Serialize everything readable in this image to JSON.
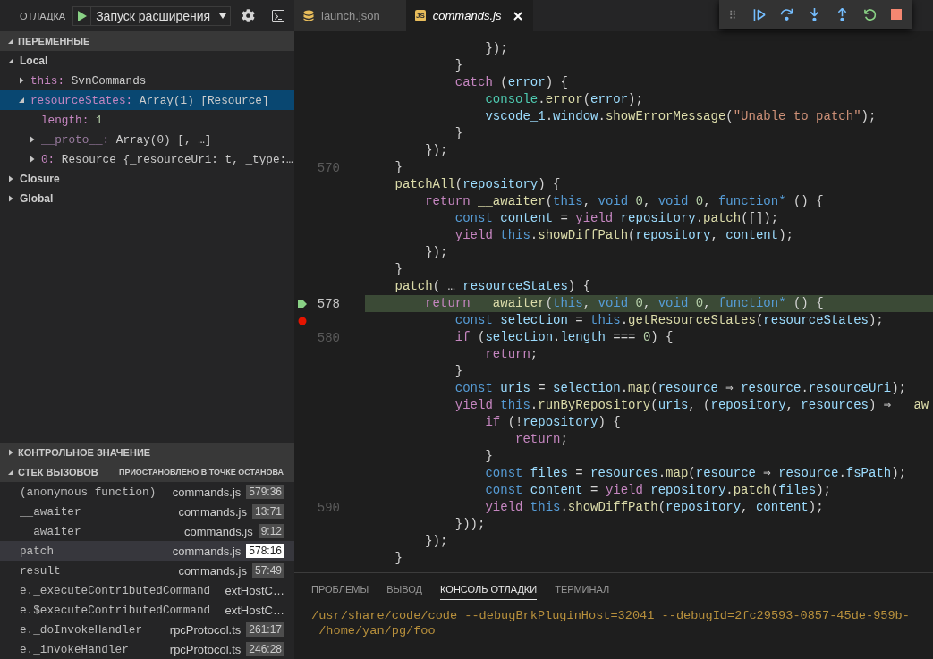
{
  "sidebar": {
    "title": "ОТЛАДКА",
    "config": {
      "label": "Запуск расширения"
    },
    "variables": {
      "title": "ПЕРЕМЕННЫЕ",
      "expanded": true,
      "items": [
        {
          "kind": "scope",
          "name": "Local",
          "expanded": true,
          "selected": false,
          "children": [
            {
              "kind": "object",
              "name": "this:",
              "value": "SvnCommands",
              "expanded": false,
              "selected": false
            },
            {
              "kind": "object",
              "name": "resourceStates:",
              "value": "Array(1) [Resource]",
              "expanded": true,
              "selected": true,
              "children": [
                {
                  "kind": "number",
                  "name": "length:",
                  "value": "1",
                  "selected": false
                },
                {
                  "kind": "object",
                  "name": "__proto__:",
                  "value": "Array(0) [, …]",
                  "expanded": false,
                  "selected": false
                },
                {
                  "kind": "object",
                  "name": "0:",
                  "value": "Resource {_resourceUri: t, _type:…",
                  "expanded": false,
                  "selected": false
                }
              ]
            }
          ]
        },
        {
          "kind": "scope",
          "name": "Closure",
          "expanded": false,
          "selected": false
        },
        {
          "kind": "scope",
          "name": "Global",
          "expanded": false,
          "selected": false
        }
      ]
    },
    "watch": {
      "title": "КОНТРОЛЬНОЕ ЗНАЧЕНИЕ",
      "expanded": false
    },
    "call_stack": {
      "title": "СТЕК ВЫЗОВОВ",
      "expanded": true,
      "status": "ПРИОСТАНОВЛЕНО В ТОЧКЕ ОСТАНОВА",
      "frames": [
        {
          "name": "(anonymous function)",
          "file": "commands.js",
          "position": "579:36",
          "selected": false
        },
        {
          "name": "__awaiter",
          "file": "commands.js",
          "position": "13:71",
          "selected": false
        },
        {
          "name": "__awaiter",
          "file": "commands.js",
          "position": "9:12",
          "selected": false
        },
        {
          "name": "patch",
          "file": "commands.js",
          "position": "578:16",
          "selected": true
        },
        {
          "name": "result",
          "file": "commands.js",
          "position": "57:49",
          "selected": false
        },
        {
          "name": "e._executeContributedCommand",
          "file": "extHostC…",
          "selected": false
        },
        {
          "name": "e.$executeContributedCommand",
          "file": "extHostC…",
          "selected": false
        },
        {
          "name": "e._doInvokeHandler",
          "file": "rpcProtocol.ts",
          "position": "261:17",
          "selected": false
        },
        {
          "name": "e._invokeHandler",
          "file": "rpcProtocol.ts",
          "position": "246:28",
          "selected": false
        }
      ]
    }
  },
  "tabs": [
    {
      "label": "launch.json",
      "kind": "json",
      "selected": false
    },
    {
      "label": "commands.js",
      "kind": "js",
      "badge": "JS",
      "selected": true
    }
  ],
  "debug_toolbar": [
    {
      "kind": "continue"
    },
    {
      "kind": "step-over"
    },
    {
      "kind": "step-into"
    },
    {
      "kind": "step-out"
    },
    {
      "kind": "restart"
    },
    {
      "kind": "stop"
    }
  ],
  "code": {
    "lines": [
      {
        "current": false,
        "breakpoint": false,
        "tokens": [
          {
            "kind": "p",
            "text": "                });"
          }
        ]
      },
      {
        "current": false,
        "breakpoint": false,
        "tokens": [
          {
            "kind": "p",
            "text": "            }"
          }
        ]
      },
      {
        "current": false,
        "breakpoint": false,
        "tokens": [
          {
            "kind": "kw",
            "text": "            catch "
          },
          {
            "kind": "p",
            "text": "("
          },
          {
            "kind": "var",
            "text": "error"
          },
          {
            "kind": "p",
            "text": ") {"
          }
        ]
      },
      {
        "current": false,
        "breakpoint": false,
        "tokens": [
          {
            "kind": "cls",
            "text": "                console"
          },
          {
            "kind": "p",
            "text": "."
          },
          {
            "kind": "fn",
            "text": "error"
          },
          {
            "kind": "p",
            "text": "("
          },
          {
            "kind": "var",
            "text": "error"
          },
          {
            "kind": "p",
            "text": ");"
          }
        ]
      },
      {
        "current": false,
        "breakpoint": false,
        "tokens": [
          {
            "kind": "var",
            "text": "                vscode_1"
          },
          {
            "kind": "p",
            "text": "."
          },
          {
            "kind": "var",
            "text": "window"
          },
          {
            "kind": "p",
            "text": "."
          },
          {
            "kind": "fn",
            "text": "showErrorMessage"
          },
          {
            "kind": "p",
            "text": "("
          },
          {
            "kind": "str",
            "text": "\"Unable to patch\""
          },
          {
            "kind": "p",
            "text": ");"
          }
        ]
      },
      {
        "current": false,
        "breakpoint": false,
        "tokens": [
          {
            "kind": "p",
            "text": "            }"
          }
        ]
      },
      {
        "current": false,
        "breakpoint": false,
        "tokens": [
          {
            "kind": "p",
            "text": "        });"
          }
        ]
      },
      {
        "number": "570",
        "current": false,
        "breakpoint": false,
        "tokens": [
          {
            "kind": "p",
            "text": "    }"
          }
        ]
      },
      {
        "current": false,
        "breakpoint": false,
        "tokens": [
          {
            "kind": "fn",
            "text": "    patchAll"
          },
          {
            "kind": "p",
            "text": "("
          },
          {
            "kind": "var",
            "text": "repository"
          },
          {
            "kind": "p",
            "text": ") {"
          }
        ]
      },
      {
        "current": false,
        "breakpoint": false,
        "tokens": [
          {
            "kind": "kw",
            "text": "        return "
          },
          {
            "kind": "fn",
            "text": "__awaiter"
          },
          {
            "kind": "p",
            "text": "("
          },
          {
            "kind": "st",
            "text": "this"
          },
          {
            "kind": "p",
            "text": ", "
          },
          {
            "kind": "st",
            "text": "void "
          },
          {
            "kind": "num",
            "text": "0"
          },
          {
            "kind": "p",
            "text": ", "
          },
          {
            "kind": "st",
            "text": "void "
          },
          {
            "kind": "num",
            "text": "0"
          },
          {
            "kind": "p",
            "text": ", "
          },
          {
            "kind": "st",
            "text": "function* "
          },
          {
            "kind": "p",
            "text": "() {"
          }
        ]
      },
      {
        "current": false,
        "breakpoint": false,
        "tokens": [
          {
            "kind": "st",
            "text": "            const "
          },
          {
            "kind": "var",
            "text": "content"
          },
          {
            "kind": "p",
            "text": " = "
          },
          {
            "kind": "kw",
            "text": "yield "
          },
          {
            "kind": "var",
            "text": "repository"
          },
          {
            "kind": "p",
            "text": "."
          },
          {
            "kind": "fn",
            "text": "patch"
          },
          {
            "kind": "p",
            "text": "([]);"
          }
        ]
      },
      {
        "current": false,
        "breakpoint": false,
        "tokens": [
          {
            "kind": "kw",
            "text": "            yield "
          },
          {
            "kind": "st",
            "text": "this"
          },
          {
            "kind": "p",
            "text": "."
          },
          {
            "kind": "fn",
            "text": "showDiffPath"
          },
          {
            "kind": "p",
            "text": "("
          },
          {
            "kind": "var",
            "text": "repository"
          },
          {
            "kind": "p",
            "text": ", "
          },
          {
            "kind": "var",
            "text": "content"
          },
          {
            "kind": "p",
            "text": ");"
          }
        ]
      },
      {
        "current": false,
        "breakpoint": false,
        "tokens": [
          {
            "kind": "p",
            "text": "        });"
          }
        ]
      },
      {
        "current": false,
        "breakpoint": false,
        "tokens": [
          {
            "kind": "p",
            "text": "    }"
          }
        ]
      },
      {
        "current": false,
        "breakpoint": false,
        "tokens": [
          {
            "kind": "fn",
            "text": "    patch"
          },
          {
            "kind": "p",
            "text": "( … "
          },
          {
            "kind": "var",
            "text": "resourceStates"
          },
          {
            "kind": "p",
            "text": ") {"
          }
        ]
      },
      {
        "number": "578",
        "current": true,
        "breakpoint": false,
        "tokens": [
          {
            "kind": "kw",
            "text": "        return "
          },
          {
            "kind": "fn",
            "text": "__awaiter"
          },
          {
            "kind": "p",
            "text": "("
          },
          {
            "kind": "st",
            "text": "this"
          },
          {
            "kind": "p",
            "text": ", "
          },
          {
            "kind": "st",
            "text": "void "
          },
          {
            "kind": "num",
            "text": "0"
          },
          {
            "kind": "p",
            "text": ", "
          },
          {
            "kind": "st",
            "text": "void "
          },
          {
            "kind": "num",
            "text": "0"
          },
          {
            "kind": "p",
            "text": ", "
          },
          {
            "kind": "st",
            "text": "function* "
          },
          {
            "kind": "p",
            "text": "() {"
          }
        ]
      },
      {
        "current": false,
        "breakpoint": true,
        "tokens": [
          {
            "kind": "st",
            "text": "            const "
          },
          {
            "kind": "var",
            "text": "selection"
          },
          {
            "kind": "p",
            "text": " = "
          },
          {
            "kind": "st",
            "text": "this"
          },
          {
            "kind": "p",
            "text": "."
          },
          {
            "kind": "fn",
            "text": "getResourceStates"
          },
          {
            "kind": "p",
            "text": "("
          },
          {
            "kind": "var",
            "text": "resourceStates"
          },
          {
            "kind": "p",
            "text": ");"
          }
        ]
      },
      {
        "number": "580",
        "current": false,
        "breakpoint": false,
        "tokens": [
          {
            "kind": "kw",
            "text": "            if "
          },
          {
            "kind": "p",
            "text": "("
          },
          {
            "kind": "var",
            "text": "selection"
          },
          {
            "kind": "p",
            "text": "."
          },
          {
            "kind": "var",
            "text": "length"
          },
          {
            "kind": "p",
            "text": " === "
          },
          {
            "kind": "num",
            "text": "0"
          },
          {
            "kind": "p",
            "text": ") {"
          }
        ]
      },
      {
        "current": false,
        "breakpoint": false,
        "tokens": [
          {
            "kind": "kw",
            "text": "                return"
          },
          {
            "kind": "p",
            "text": ";"
          }
        ]
      },
      {
        "current": false,
        "breakpoint": false,
        "tokens": [
          {
            "kind": "p",
            "text": "            }"
          }
        ]
      },
      {
        "current": false,
        "breakpoint": false,
        "tokens": [
          {
            "kind": "st",
            "text": "            const "
          },
          {
            "kind": "var",
            "text": "uris"
          },
          {
            "kind": "p",
            "text": " = "
          },
          {
            "kind": "var",
            "text": "selection"
          },
          {
            "kind": "p",
            "text": "."
          },
          {
            "kind": "fn",
            "text": "map"
          },
          {
            "kind": "p",
            "text": "("
          },
          {
            "kind": "var",
            "text": "resource"
          },
          {
            "kind": "p",
            "text": " ⇒ "
          },
          {
            "kind": "var",
            "text": "resource"
          },
          {
            "kind": "p",
            "text": "."
          },
          {
            "kind": "var",
            "text": "resourceUri"
          },
          {
            "kind": "p",
            "text": ");"
          }
        ]
      },
      {
        "current": false,
        "breakpoint": false,
        "tokens": [
          {
            "kind": "kw",
            "text": "            yield "
          },
          {
            "kind": "st",
            "text": "this"
          },
          {
            "kind": "p",
            "text": "."
          },
          {
            "kind": "fn",
            "text": "runByRepository"
          },
          {
            "kind": "p",
            "text": "("
          },
          {
            "kind": "var",
            "text": "uris"
          },
          {
            "kind": "p",
            "text": ", ("
          },
          {
            "kind": "var",
            "text": "repository"
          },
          {
            "kind": "p",
            "text": ", "
          },
          {
            "kind": "var",
            "text": "resources"
          },
          {
            "kind": "p",
            "text": ") ⇒ "
          },
          {
            "kind": "fn",
            "text": "__aw"
          }
        ]
      },
      {
        "current": false,
        "breakpoint": false,
        "tokens": [
          {
            "kind": "kw",
            "text": "                if "
          },
          {
            "kind": "p",
            "text": "(!"
          },
          {
            "kind": "var",
            "text": "repository"
          },
          {
            "kind": "p",
            "text": ") {"
          }
        ]
      },
      {
        "current": false,
        "breakpoint": false,
        "tokens": [
          {
            "kind": "kw",
            "text": "                    return"
          },
          {
            "kind": "p",
            "text": ";"
          }
        ]
      },
      {
        "current": false,
        "breakpoint": false,
        "tokens": [
          {
            "kind": "p",
            "text": "                }"
          }
        ]
      },
      {
        "current": false,
        "breakpoint": false,
        "tokens": [
          {
            "kind": "st",
            "text": "                const "
          },
          {
            "kind": "var",
            "text": "files"
          },
          {
            "kind": "p",
            "text": " = "
          },
          {
            "kind": "var",
            "text": "resources"
          },
          {
            "kind": "p",
            "text": "."
          },
          {
            "kind": "fn",
            "text": "map"
          },
          {
            "kind": "p",
            "text": "("
          },
          {
            "kind": "var",
            "text": "resource"
          },
          {
            "kind": "p",
            "text": " ⇒ "
          },
          {
            "kind": "var",
            "text": "resource"
          },
          {
            "kind": "p",
            "text": "."
          },
          {
            "kind": "var",
            "text": "fsPath"
          },
          {
            "kind": "p",
            "text": ");"
          }
        ]
      },
      {
        "current": false,
        "breakpoint": false,
        "tokens": [
          {
            "kind": "st",
            "text": "                const "
          },
          {
            "kind": "var",
            "text": "content"
          },
          {
            "kind": "p",
            "text": " = "
          },
          {
            "kind": "kw",
            "text": "yield "
          },
          {
            "kind": "var",
            "text": "repository"
          },
          {
            "kind": "p",
            "text": "."
          },
          {
            "kind": "fn",
            "text": "patch"
          },
          {
            "kind": "p",
            "text": "("
          },
          {
            "kind": "var",
            "text": "files"
          },
          {
            "kind": "p",
            "text": ");"
          }
        ]
      },
      {
        "number": "590",
        "current": false,
        "breakpoint": false,
        "tokens": [
          {
            "kind": "kw",
            "text": "                yield "
          },
          {
            "kind": "st",
            "text": "this"
          },
          {
            "kind": "p",
            "text": "."
          },
          {
            "kind": "fn",
            "text": "showDiffPath"
          },
          {
            "kind": "p",
            "text": "("
          },
          {
            "kind": "var",
            "text": "repository"
          },
          {
            "kind": "p",
            "text": ", "
          },
          {
            "kind": "var",
            "text": "content"
          },
          {
            "kind": "p",
            "text": ");"
          }
        ]
      },
      {
        "current": false,
        "breakpoint": false,
        "tokens": [
          {
            "kind": "p",
            "text": "            }));"
          }
        ]
      },
      {
        "current": false,
        "breakpoint": false,
        "tokens": [
          {
            "kind": "p",
            "text": "        });"
          }
        ]
      },
      {
        "current": false,
        "breakpoint": false,
        "tokens": [
          {
            "kind": "p",
            "text": "    }"
          }
        ]
      }
    ]
  },
  "panel": {
    "tabs": [
      {
        "label": "ПРОБЛЕМЫ",
        "selected": false
      },
      {
        "label": "ВЫВОД",
        "selected": false
      },
      {
        "label": "КОНСОЛЬ ОТЛАДКИ",
        "selected": true
      },
      {
        "label": "ТЕРМИНАЛ",
        "selected": false
      }
    ],
    "output": [
      "/usr/share/code/code --debugBrkPluginHost=32041 --debugId=2fc29593-0857-45de-959b-",
      " /home/yan/pg/foo"
    ]
  }
}
